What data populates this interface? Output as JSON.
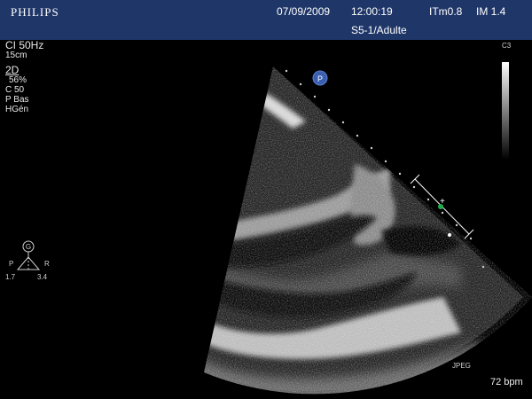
{
  "header": {
    "logo": "PHILIPS",
    "date": "07/09/2009",
    "time": "12:00:19",
    "thermal_index": "ITm0.8",
    "mechanical_index": "IM 1.4",
    "probe_preset": "S5-1/Adulte"
  },
  "params": {
    "frame_rate": "CI 50Hz",
    "depth": "15cm",
    "mode": "2D",
    "gain": "56%",
    "compression": "C 50",
    "power": "P Bas",
    "harmonic": "HGén"
  },
  "grayscale": {
    "label": "C3"
  },
  "orientation": {
    "marker": "G",
    "left_label": "P",
    "right_label": "R",
    "left_value": "1.7",
    "right_value": "3.4"
  },
  "focus_marker": "P",
  "status": {
    "capture_format": "JPEG",
    "heart_rate": "72 bpm"
  },
  "colors": {
    "header_bg": "#1f3668",
    "text": "#ffffff",
    "marker_blue": "#3a5fb0",
    "caliper_green": "#1fae4a"
  }
}
